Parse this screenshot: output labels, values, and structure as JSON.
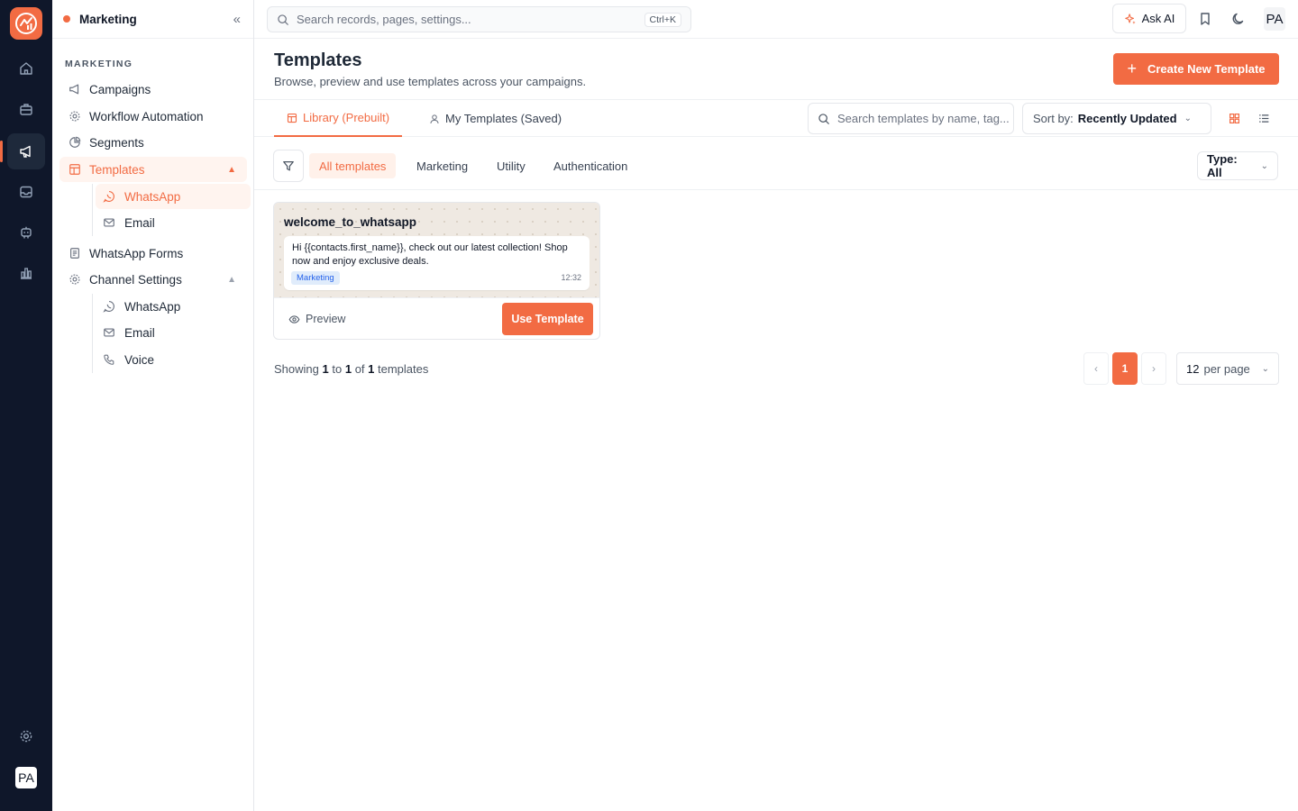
{
  "rail": {
    "items": [
      {
        "icon": "home-icon",
        "active": false
      },
      {
        "icon": "briefcase-icon",
        "active": false
      },
      {
        "icon": "megaphone-icon",
        "active": true
      },
      {
        "icon": "inbox-icon",
        "active": false
      },
      {
        "icon": "bot-icon",
        "active": false
      },
      {
        "icon": "bar-chart-icon",
        "active": false
      }
    ],
    "settings_icon": "settings-icon",
    "avatar_initials": "PA"
  },
  "sidebar": {
    "title": "Marketing",
    "section_label": "MARKETING",
    "items": [
      {
        "label": "Campaigns",
        "icon": "megaphone-icon"
      },
      {
        "label": "Workflow Automation",
        "icon": "workflow-icon"
      },
      {
        "label": "Segments",
        "icon": "pie-chart-icon"
      },
      {
        "label": "Templates",
        "icon": "layout-template-icon",
        "expanded": true,
        "selected": true
      },
      {
        "label": "WhatsApp Forms",
        "icon": "form-icon"
      },
      {
        "label": "Channel Settings",
        "icon": "settings-icon",
        "expanded": true
      }
    ],
    "templates_sub": [
      {
        "label": "WhatsApp",
        "icon": "whatsapp-icon",
        "selected": true
      },
      {
        "label": "Email",
        "icon": "mail-icon"
      }
    ],
    "channel_sub": [
      {
        "label": "WhatsApp",
        "icon": "whatsapp-icon"
      },
      {
        "label": "Email",
        "icon": "mail-icon"
      },
      {
        "label": "Voice",
        "icon": "phone-icon"
      }
    ]
  },
  "topbar": {
    "search_placeholder": "Search records, pages, settings...",
    "search_shortcut": "Ctrl+K",
    "ask_ai_label": "Ask AI",
    "avatar_initials": "PA"
  },
  "page": {
    "title": "Templates",
    "subtitle": "Browse, preview and use templates across your campaigns.",
    "create_button": "Create New Template"
  },
  "tabs": [
    {
      "label": "Library (Prebuilt)",
      "active": true
    },
    {
      "label": "My Templates (Saved)",
      "active": false
    }
  ],
  "toolbar": {
    "search_placeholder": "Search templates by name, tag...",
    "sort_prefix": "Sort by:",
    "sort_value": "Recently Updated"
  },
  "filters": {
    "chips": [
      {
        "label": "All templates",
        "active": true
      },
      {
        "label": "Marketing",
        "active": false
      },
      {
        "label": "Utility",
        "active": false
      },
      {
        "label": "Authentication",
        "active": false
      }
    ],
    "type_label": "Type: All"
  },
  "templates": [
    {
      "name": "welcome_to_whatsapp",
      "body": "Hi {{contacts.first_name}}, check out our latest collection! Shop now and enjoy exclusive deals.",
      "category": "Marketing",
      "time": "12:32",
      "preview_label": "Preview",
      "use_label": "Use Template"
    }
  ],
  "pagination": {
    "prefix": "Showing",
    "from": "1",
    "to_word": "to",
    "to": "1",
    "of_word": "of",
    "total": "1",
    "suffix": "templates",
    "current_page": "1",
    "per_page_value": "12",
    "per_page_suffix": "per page"
  },
  "colors": {
    "accent": "#f26b43",
    "rail_bg": "#0f172a",
    "badge_bg": "#e0ecfb",
    "badge_text": "#2563eb"
  }
}
